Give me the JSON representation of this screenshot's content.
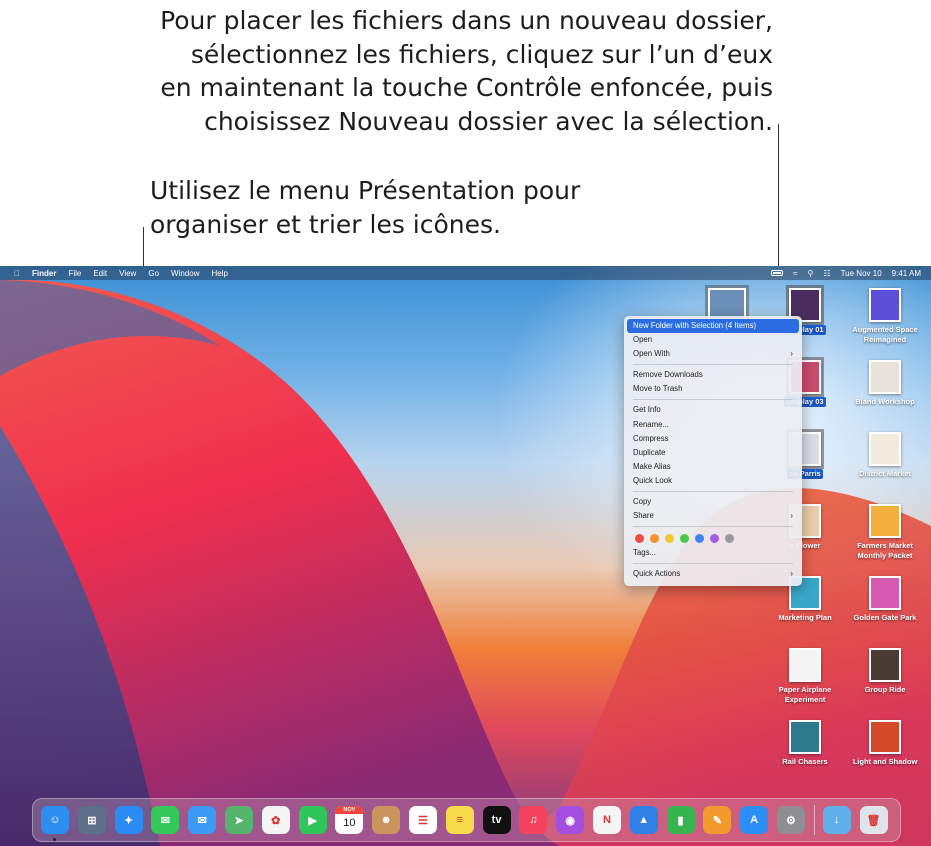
{
  "callouts": {
    "top": [
      "Pour placer les fichiers dans un nouveau dossier,",
      "sélectionnez les fichiers, cliquez sur l’un d’eux",
      "en maintenant la touche Contrôle enfoncée, puis",
      "choisissez Nouveau dossier avec la sélection."
    ],
    "left": [
      "Utilisez le menu Présentation pour",
      "organiser et trier les icônes."
    ]
  },
  "menubar": {
    "apple_icon": "apple-icon",
    "items": [
      "Finder",
      "File",
      "Edit",
      "View",
      "Go",
      "Window",
      "Help"
    ],
    "date": "Tue Nov 10",
    "time": "9:41 AM"
  },
  "context_menu": {
    "items": [
      {
        "label": "New Folder with Selection (4 Items)",
        "highlighted": true
      },
      {
        "label": "Open"
      },
      {
        "label": "Open With",
        "submenu": true
      },
      {
        "sep": true
      },
      {
        "label": "Remove Downloads"
      },
      {
        "label": "Move to Trash"
      },
      {
        "sep": true
      },
      {
        "label": "Get Info"
      },
      {
        "label": "Rename..."
      },
      {
        "label": "Compress"
      },
      {
        "label": "Duplicate"
      },
      {
        "label": "Make Alias"
      },
      {
        "label": "Quick Look"
      },
      {
        "sep": true
      },
      {
        "label": "Copy"
      },
      {
        "label": "Share",
        "submenu": true
      },
      {
        "sep": true
      },
      {
        "tags": true
      },
      {
        "label": "Tags..."
      },
      {
        "sep": true
      },
      {
        "label": "Quick Actions",
        "submenu": true
      }
    ],
    "tag_colors": [
      "#ee4c45",
      "#f5922b",
      "#f7c72f",
      "#4cc74a",
      "#3b82f6",
      "#a35de0",
      "#9a9a9e"
    ],
    "submenu_arrow": "›"
  },
  "desktop_icons": [
    {
      "label": "Display 01",
      "selected": true,
      "color": "#4a2d5e"
    },
    {
      "label": "Augmented Space Reimagined",
      "selected": false,
      "color": "#5b4fd8"
    },
    {
      "label": "Display 03",
      "selected": true,
      "color": "#c94c6f"
    },
    {
      "label": "Bland Workshop",
      "selected": false,
      "color": "#e8e3da"
    },
    {
      "label": "sa Parris",
      "selected": true,
      "color": "#d9dde4"
    },
    {
      "label": "District Market",
      "selected": false,
      "color": "#f2ece0"
    },
    {
      "label": "o Flower",
      "selected": false,
      "color": "#e9cfa9"
    },
    {
      "label": "Farmers Market Monthly Packet",
      "selected": false,
      "color": "#f3b03c"
    },
    {
      "label": "Marketing Plan",
      "selected": false,
      "color": "#3aa7c9"
    },
    {
      "label": "Golden Gate Park",
      "selected": false,
      "color": "#d65ab2"
    },
    {
      "label": "Paper Airplane Experiment",
      "selected": false,
      "color": "#f4f4f4"
    },
    {
      "label": "Group Ride",
      "selected": false,
      "color": "#4a3c34"
    },
    {
      "label": "Rail Chasers",
      "selected": false,
      "color": "#2d7a8c"
    },
    {
      "label": "Light and Shadow",
      "selected": false,
      "color": "#d44a28"
    }
  ],
  "dock": {
    "apps": [
      {
        "name": "finder-icon",
        "color": "#2e8ef0",
        "glyph": "☺",
        "running": true
      },
      {
        "name": "launchpad-icon",
        "color": "#5e6f8a",
        "glyph": "⊞"
      },
      {
        "name": "safari-icon",
        "color": "#2a8bf2",
        "glyph": "✦"
      },
      {
        "name": "messages-icon",
        "color": "#34c759",
        "glyph": "✉"
      },
      {
        "name": "mail-icon",
        "color": "#3c9af5",
        "glyph": "✉"
      },
      {
        "name": "maps-icon",
        "color": "#55b46b",
        "glyph": "➤"
      },
      {
        "name": "photos-icon",
        "color": "#f5f5f5",
        "glyph": "✿"
      },
      {
        "name": "facetime-icon",
        "color": "#2ec55a",
        "glyph": "▶"
      },
      {
        "name": "calendar-icon",
        "color": "#ffffff",
        "glyph": "10",
        "badge": "NOV"
      },
      {
        "name": "contacts-icon",
        "color": "#c9955c",
        "glyph": "☻"
      },
      {
        "name": "reminders-icon",
        "color": "#ffffff",
        "glyph": "☰"
      },
      {
        "name": "notes-icon",
        "color": "#f7d94c",
        "glyph": "≡"
      },
      {
        "name": "apple-tv-icon",
        "color": "#111111",
        "glyph": "tv"
      },
      {
        "name": "music-icon",
        "color": "#f5425e",
        "glyph": "♫"
      },
      {
        "name": "podcasts-icon",
        "color": "#a54fe0",
        "glyph": "◉"
      },
      {
        "name": "news-icon",
        "color": "#f5f5f5",
        "glyph": "N"
      },
      {
        "name": "keynote-icon",
        "color": "#2f7fe6",
        "glyph": "▲"
      },
      {
        "name": "numbers-icon",
        "color": "#35b34c",
        "glyph": "▮"
      },
      {
        "name": "pages-icon",
        "color": "#f39a2e",
        "glyph": "✎"
      },
      {
        "name": "app-store-icon",
        "color": "#2b8ff6",
        "glyph": "A"
      },
      {
        "name": "system-preferences-icon",
        "color": "#8e8e93",
        "glyph": "⚙"
      }
    ],
    "stack": [
      {
        "name": "downloads-folder-icon",
        "color": "#5fb0ea",
        "glyph": "↓"
      },
      {
        "name": "trash-icon",
        "color": "#dfe4ea",
        "glyph": "🗑"
      }
    ]
  }
}
